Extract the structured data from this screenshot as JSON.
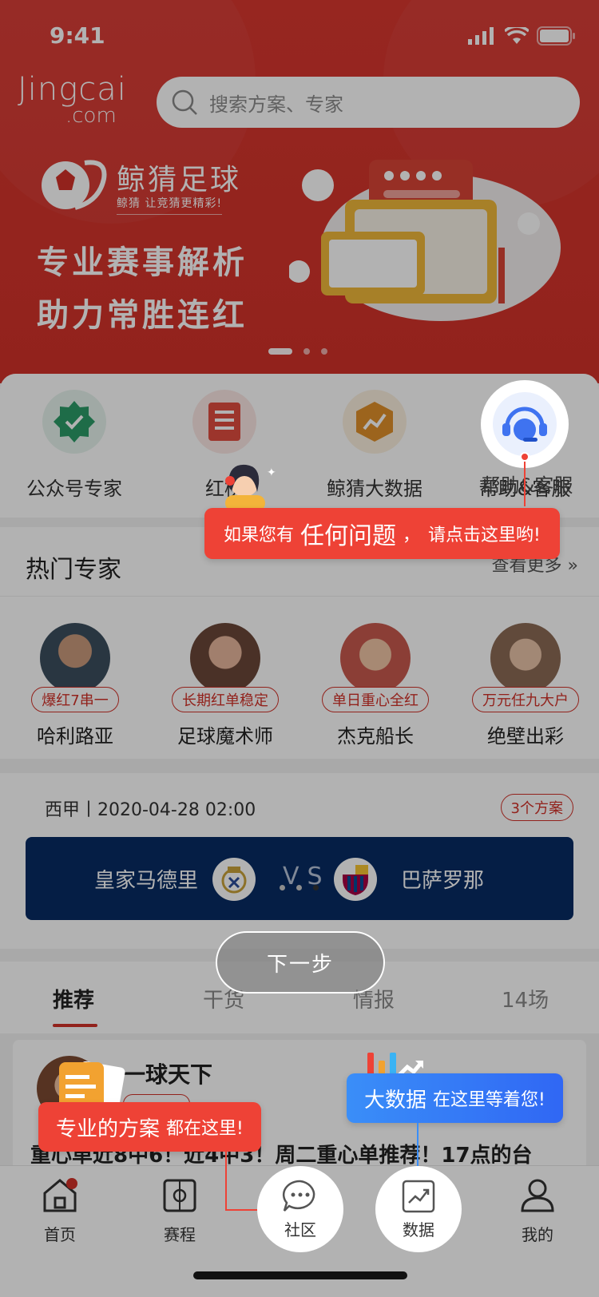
{
  "status_bar": {
    "time": "9:41"
  },
  "header": {
    "logo_line1": "Jingcai",
    "logo_line2": ".com",
    "search_placeholder": "搜索方案、专家"
  },
  "banner": {
    "brand_name": "鲸猜足球",
    "brand_slogan": "鲸猜 让竞猜更精彩!",
    "title_line1": "专业赛事解析",
    "title_line2": "助力常胜连红",
    "active_slide": 1,
    "slide_count": 3
  },
  "quick_entries": [
    {
      "label": "公众号专家",
      "icon": "verified-badge-icon",
      "color": "#2b9b67"
    },
    {
      "label": "红榜",
      "icon": "list-doc-icon",
      "color": "#e04c3f"
    },
    {
      "label": "鲸猜大数据",
      "icon": "data-chart-icon",
      "color": "#e0902a"
    },
    {
      "label": "帮助&客服",
      "icon": "customer-service-icon",
      "color": "#3f73f0"
    }
  ],
  "hot_experts": {
    "title": "热门专家",
    "see_more": "查看更多",
    "items": [
      {
        "name": "哈利路亚",
        "badge": "爆红7串一"
      },
      {
        "name": "足球魔术师",
        "badge": "长期红单稳定"
      },
      {
        "name": "杰克船长",
        "badge": "单日重心全红"
      },
      {
        "name": "绝壁出彩",
        "badge": "万元任九大户"
      }
    ]
  },
  "match": {
    "league_time": "西甲丨2020-04-28 02:00",
    "plans": "3个方案",
    "home": "皇家马德里",
    "vs": "VS",
    "away": "巴萨罗那"
  },
  "content_tabs": [
    "推荐",
    "干货",
    "情报",
    "14场"
  ],
  "feed": {
    "user": "一球天下",
    "text": "重心单近8中6！近4中3！周二重心单推荐！17点的台"
  },
  "tabbar": [
    {
      "label": "首页",
      "icon": "home-icon"
    },
    {
      "label": "赛程",
      "icon": "schedule-icon"
    },
    {
      "label": "社区",
      "icon": "chat-bubble-icon"
    },
    {
      "label": "数据",
      "icon": "trend-chart-icon"
    },
    {
      "label": "我的",
      "icon": "user-icon"
    }
  ],
  "guide": {
    "help_tip": {
      "pre": "如果您有",
      "big": "任何问题",
      "comma": "，",
      "post": "请点击这里哟!"
    },
    "plan_tip": {
      "big": "专业的方案",
      "post": "都在这里!"
    },
    "data_tip": {
      "big": "大数据",
      "post": "在这里等着您!"
    },
    "next_button": "下一步"
  },
  "colors": {
    "brand_red": "#d23229",
    "navy": "#082c63",
    "guide_blue": "#3067f4"
  }
}
